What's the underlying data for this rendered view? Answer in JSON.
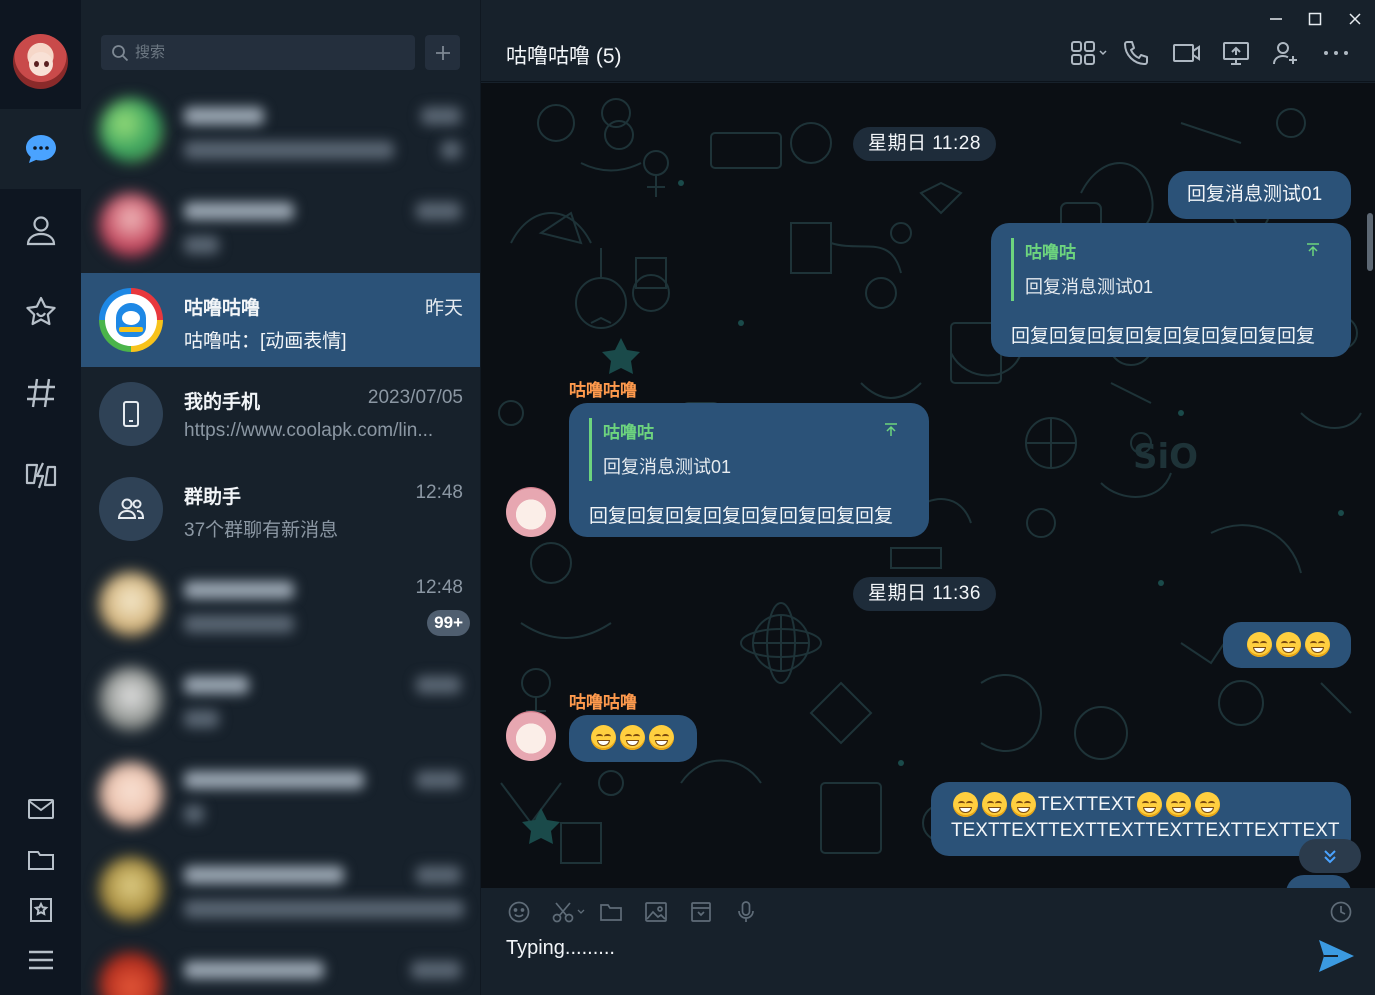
{
  "colors": {
    "rail_bg": "#0e1621",
    "panel_bg": "#17212b",
    "accent": "#2b5278",
    "active_icon": "#4aa3ff",
    "quote_green": "#6dd47e",
    "sender_orange": "#ff9a4d",
    "send_blue": "#3b9ae1"
  },
  "rail": {
    "icons": [
      "chat-bubble-icon",
      "contact-icon",
      "star-icon",
      "hashtag-icon",
      "flash-icon"
    ],
    "bottom_icons": [
      "mail-icon",
      "folder-icon",
      "bookmark-star-icon",
      "menu-icon"
    ]
  },
  "search": {
    "placeholder": "搜索",
    "add_icon": "plus-icon"
  },
  "chats": [
    {
      "name": "",
      "time": "",
      "preview": "",
      "blurred": true
    },
    {
      "name": "",
      "time": "",
      "preview": "",
      "blurred": true
    },
    {
      "name": "咕噜咕噜",
      "time": "昨天",
      "preview": "咕噜咕：[动画表情]",
      "active": true
    },
    {
      "name": "我的手机",
      "time": "2023/07/05",
      "preview": "https://www.coolapk.com/lin..."
    },
    {
      "name": "群助手",
      "time": "12:48",
      "preview": "37个群聊有新消息"
    },
    {
      "name": "",
      "time": "12:48",
      "preview": "",
      "badge": "99+",
      "blurred": true
    },
    {
      "name": "",
      "time": "",
      "preview": "",
      "blurred": true
    },
    {
      "name": "",
      "time": "",
      "preview": "",
      "blurred": true
    },
    {
      "name": "",
      "time": "",
      "preview": "",
      "blurred": true
    },
    {
      "name": "",
      "time": "",
      "preview": "",
      "blurred": true
    }
  ],
  "header": {
    "title": "咕噜咕噜 (5)",
    "icons": [
      "apps-icon",
      "phone-icon",
      "video-icon",
      "screen-share-icon",
      "add-member-icon",
      "more-icon"
    ],
    "window_controls": [
      "minimize-icon",
      "maximize-icon",
      "close-icon"
    ]
  },
  "messages": {
    "date1": "星期日 11:28",
    "out1": "回复消息测试01",
    "out2": {
      "quote_author": "咕噜咕",
      "quote_text": "回复消息测试01",
      "text": "回复回复回复回复回复回复回复回复"
    },
    "in1": {
      "sender": "咕噜咕噜",
      "quote_author": "咕噜咕",
      "quote_text": "回复消息测试01",
      "text": "回复回复回复回复回复回复回复回复"
    },
    "date2": "星期日 11:36",
    "in2_sender": "咕噜咕噜",
    "out4": {
      "line1": "TEXTTEXT",
      "line2": "TEXTTEXTTEXTTEXTTEXTTEXTTEXTTEXT"
    }
  },
  "composer": {
    "icons": [
      "emoji-icon",
      "scissors-icon",
      "folder-icon",
      "image-icon",
      "card-icon",
      "microphone-icon",
      "clock-icon"
    ],
    "typing": "Typing.........",
    "send_icon": "send-icon"
  }
}
